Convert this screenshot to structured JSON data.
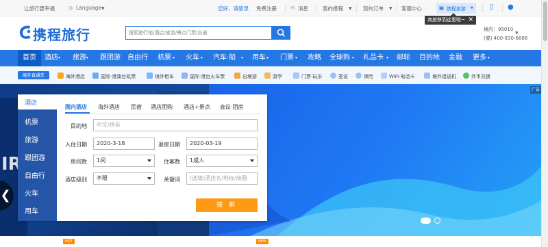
{
  "topbar": {
    "slogan": "让旅行更幸福",
    "language": "Language",
    "greeting": "您好，请登录",
    "register": "免费注册",
    "messages": "消息",
    "my_trips": "我的携程",
    "my_orders": "我的订单",
    "service": "客服中心",
    "brand_menu": "携程旅游"
  },
  "tooltip": {
    "text": "商旅移到这里啦~",
    "close": "✕"
  },
  "header": {
    "logo": "携程旅行",
    "search_placeholder": "搜索旅行地/酒店/旅游/景点门票/交通",
    "phone_domestic": "境内：95010",
    "phone_intl": "(或) 400-830-6666"
  },
  "mainnav": {
    "items": [
      "首页",
      "酒店",
      "旅游",
      "跟团游",
      "自由行",
      "机票",
      "火车",
      "汽车·船",
      "用车",
      "门票",
      "攻略",
      "全球购",
      "礼品卡",
      "邮轮",
      "目的地",
      "金融",
      "更多"
    ]
  },
  "subnav": {
    "badge": "境外直通车",
    "items": [
      "海外酒店",
      "国际·港澳台机票",
      "境外租车",
      "国际·港台火车票",
      "出境游",
      "游学",
      "门票·玩乐",
      "签证",
      "保险",
      "WiFi·电话卡",
      "境外接送机",
      "外币兑换"
    ]
  },
  "booking": {
    "side_categories": [
      "酒店",
      "机票",
      "旅游",
      "跟团游",
      "自由行",
      "火车",
      "用车"
    ],
    "tabs": [
      "国内酒店",
      "海外酒店",
      "民宿",
      "酒店团购",
      "酒店+景点",
      "会议·团房"
    ],
    "destination_label": "目的地",
    "destination_placeholder": "中文/拼音",
    "checkin_label": "入住日期",
    "checkin_value": "2020-3-18",
    "checkout_label": "退房日期",
    "checkout_value": "2020-03-19",
    "rooms_label": "房间数",
    "rooms_value": "1间",
    "guests_label": "住客数",
    "guests_value": "1成人",
    "level_label": "酒店级别",
    "level_value": "不限",
    "keyword_label": "关键词",
    "keyword_placeholder": "(选填)酒店名/地标/商圈",
    "submit": "搜 索"
  },
  "hero": {
    "ad_label": "广告",
    "prev": "❮"
  },
  "bottom": {
    "hot": "HOT",
    "new": "NEW"
  },
  "colors": {
    "primary": "#2577e3",
    "accent": "#ff9a14",
    "nav_active": "#0d5bc4"
  }
}
